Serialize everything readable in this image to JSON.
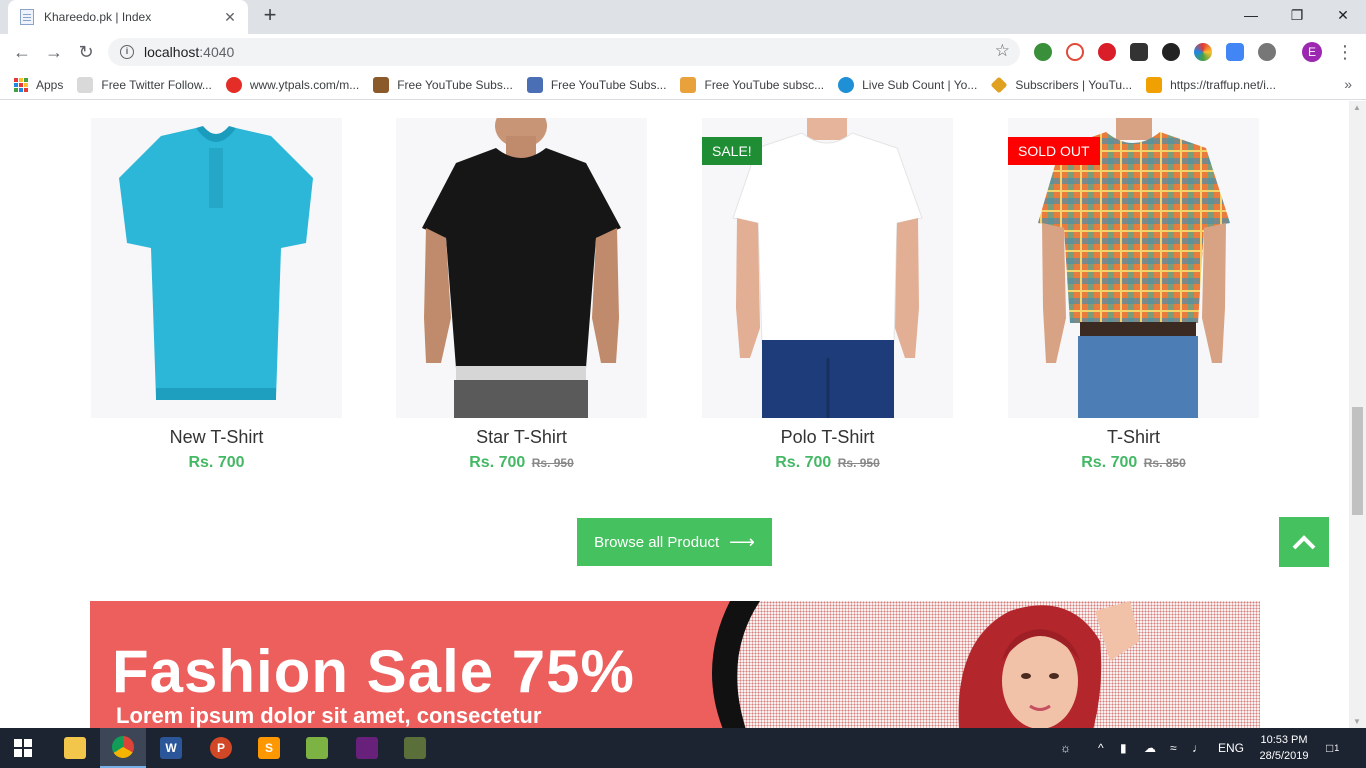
{
  "browser": {
    "tab_title": "Khareedo.pk | Index",
    "url_host": "localhost",
    "url_port": ":4040",
    "profile_initial": "E",
    "bookmarks": [
      {
        "label": "Apps"
      },
      {
        "label": "Free Twitter Follow...",
        "color": "#d9d9d9"
      },
      {
        "label": "www.ytpals.com/m...",
        "color": "#e52d27"
      },
      {
        "label": "Free YouTube Subs...",
        "color": "#8b5a2b"
      },
      {
        "label": "Free YouTube Subs...",
        "color": "#4a6fb5"
      },
      {
        "label": "Free YouTube subsc...",
        "color": "#e9a13b"
      },
      {
        "label": "Live Sub Count | Yo...",
        "color": "#1f8fd6"
      },
      {
        "label": "Subscribers | YouTu...",
        "color": "#e0a020"
      },
      {
        "label": "https://traffup.net/i...",
        "color": "#f0a000"
      }
    ]
  },
  "products": [
    {
      "name": "New T-Shirt",
      "price": "Rs. 700",
      "old_price": "",
      "badge": ""
    },
    {
      "name": "Star T-Shirt",
      "price": "Rs. 700",
      "old_price": "Rs. 950",
      "badge": ""
    },
    {
      "name": "Polo T-Shirt",
      "price": "Rs. 700",
      "old_price": "Rs. 950",
      "badge": "SALE!"
    },
    {
      "name": "T-Shirt",
      "price": "Rs. 700",
      "old_price": "Rs. 850",
      "badge": "SOLD OUT"
    }
  ],
  "browse_label": "Browse all Product",
  "banner": {
    "title": "Fashion Sale 75%",
    "subtitle": "Lorem ipsum dolor sit amet, consectetur"
  },
  "taskbar": {
    "lang": "ENG",
    "time": "10:53 PM",
    "date": "28/5/2019",
    "notifications": "1"
  },
  "colors": {
    "accent_green": "#45c15f",
    "price_green": "#45b865",
    "sale_badge": "#1e8d33",
    "soldout_badge": "#ff0000",
    "banner_red": "#ec5f5d"
  }
}
